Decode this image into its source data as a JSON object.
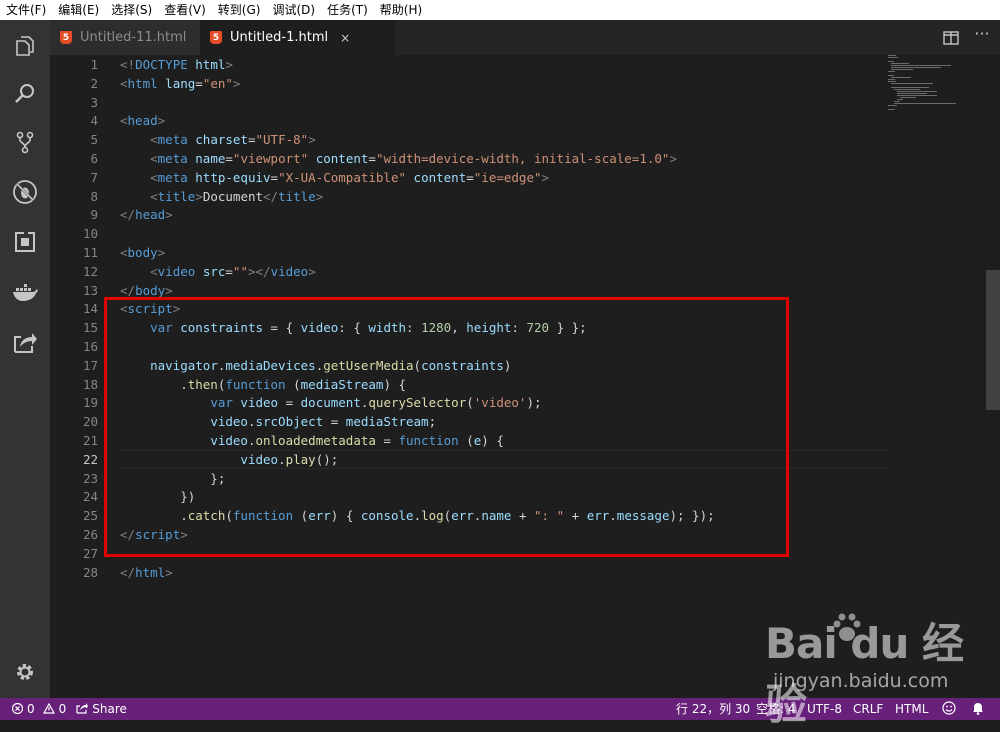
{
  "menu": [
    "文件(F)",
    "编辑(E)",
    "选择(S)",
    "查看(V)",
    "转到(G)",
    "调试(D)",
    "任务(T)",
    "帮助(H)"
  ],
  "activity_icons": [
    "files-icon",
    "search-icon",
    "source-control-icon",
    "debug-icon",
    "extensions-icon",
    "docker-icon",
    "live-share-icon",
    "settings-icon"
  ],
  "tabs": [
    {
      "label": "Untitled-11.html",
      "icon": "html5-icon",
      "active": false
    },
    {
      "label": "Untitled-1.html",
      "icon": "html5-icon",
      "active": true,
      "close": "×"
    }
  ],
  "html5_glyph": "5",
  "editor": {
    "active_line": 22,
    "highlight_box_color": "#e00000",
    "lines": [
      [
        [
          "tg",
          "<!"
        ],
        [
          "tn",
          "DOCTYPE"
        ],
        [
          "tx",
          " "
        ],
        [
          "at",
          "html"
        ],
        [
          "tg",
          ">"
        ]
      ],
      [
        [
          "tg",
          "<"
        ],
        [
          "tn",
          "html"
        ],
        [
          "tx",
          " "
        ],
        [
          "at",
          "lang"
        ],
        [
          "tx",
          "="
        ],
        [
          "st",
          "\"en\""
        ],
        [
          "tg",
          ">"
        ]
      ],
      [],
      [
        [
          "tg",
          "<"
        ],
        [
          "tn",
          "head"
        ],
        [
          "tg",
          ">"
        ]
      ],
      [
        [
          "tx",
          "    "
        ],
        [
          "tg",
          "<"
        ],
        [
          "tn",
          "meta"
        ],
        [
          "tx",
          " "
        ],
        [
          "at",
          "charset"
        ],
        [
          "tx",
          "="
        ],
        [
          "st",
          "\"UTF-8\""
        ],
        [
          "tg",
          ">"
        ]
      ],
      [
        [
          "tx",
          "    "
        ],
        [
          "tg",
          "<"
        ],
        [
          "tn",
          "meta"
        ],
        [
          "tx",
          " "
        ],
        [
          "at",
          "name"
        ],
        [
          "tx",
          "="
        ],
        [
          "st",
          "\"viewport\""
        ],
        [
          "tx",
          " "
        ],
        [
          "at",
          "content"
        ],
        [
          "tx",
          "="
        ],
        [
          "st",
          "\"width=device-width, initial-scale=1.0\""
        ],
        [
          "tg",
          ">"
        ]
      ],
      [
        [
          "tx",
          "    "
        ],
        [
          "tg",
          "<"
        ],
        [
          "tn",
          "meta"
        ],
        [
          "tx",
          " "
        ],
        [
          "at",
          "http-equiv"
        ],
        [
          "tx",
          "="
        ],
        [
          "st",
          "\"X-UA-Compatible\""
        ],
        [
          "tx",
          " "
        ],
        [
          "at",
          "content"
        ],
        [
          "tx",
          "="
        ],
        [
          "st",
          "\"ie=edge\""
        ],
        [
          "tg",
          ">"
        ]
      ],
      [
        [
          "tx",
          "    "
        ],
        [
          "tg",
          "<"
        ],
        [
          "tn",
          "title"
        ],
        [
          "tg",
          ">"
        ],
        [
          "tx",
          "Document"
        ],
        [
          "tg",
          "</"
        ],
        [
          "tn",
          "title"
        ],
        [
          "tg",
          ">"
        ]
      ],
      [
        [
          "tg",
          "</"
        ],
        [
          "tn",
          "head"
        ],
        [
          "tg",
          ">"
        ]
      ],
      [],
      [
        [
          "tg",
          "<"
        ],
        [
          "tn",
          "body"
        ],
        [
          "tg",
          ">"
        ]
      ],
      [
        [
          "tx",
          "    "
        ],
        [
          "tg",
          "<"
        ],
        [
          "tn",
          "video"
        ],
        [
          "tx",
          " "
        ],
        [
          "at",
          "src"
        ],
        [
          "tx",
          "="
        ],
        [
          "st",
          "\"\""
        ],
        [
          "tg",
          "></"
        ],
        [
          "tn",
          "video"
        ],
        [
          "tg",
          ">"
        ]
      ],
      [
        [
          "tg",
          "</"
        ],
        [
          "tn",
          "body"
        ],
        [
          "tg",
          ">"
        ]
      ],
      [
        [
          "tg",
          "<"
        ],
        [
          "tn",
          "script"
        ],
        [
          "tg",
          ">"
        ]
      ],
      [
        [
          "tx",
          "    "
        ],
        [
          "kw",
          "var"
        ],
        [
          "tx",
          " "
        ],
        [
          "vr",
          "constraints"
        ],
        [
          "tx",
          " = { "
        ],
        [
          "vr",
          "video"
        ],
        [
          "tx",
          ": { "
        ],
        [
          "vr",
          "width"
        ],
        [
          "tx",
          ": "
        ],
        [
          "nm",
          "1280"
        ],
        [
          "tx",
          ", "
        ],
        [
          "vr",
          "height"
        ],
        [
          "tx",
          ": "
        ],
        [
          "nm",
          "720"
        ],
        [
          "tx",
          " } };"
        ]
      ],
      [],
      [
        [
          "tx",
          "    "
        ],
        [
          "vr",
          "navigator"
        ],
        [
          "tx",
          "."
        ],
        [
          "vr",
          "mediaDevices"
        ],
        [
          "tx",
          "."
        ],
        [
          "fn",
          "getUserMedia"
        ],
        [
          "tx",
          "("
        ],
        [
          "vr",
          "constraints"
        ],
        [
          "tx",
          ")"
        ]
      ],
      [
        [
          "tx",
          "        ."
        ],
        [
          "fn",
          "then"
        ],
        [
          "tx",
          "("
        ],
        [
          "kw",
          "function"
        ],
        [
          "tx",
          " ("
        ],
        [
          "vr",
          "mediaStream"
        ],
        [
          "tx",
          ") {"
        ]
      ],
      [
        [
          "tx",
          "            "
        ],
        [
          "kw",
          "var"
        ],
        [
          "tx",
          " "
        ],
        [
          "vr",
          "video"
        ],
        [
          "tx",
          " = "
        ],
        [
          "vr",
          "document"
        ],
        [
          "tx",
          "."
        ],
        [
          "fn",
          "querySelector"
        ],
        [
          "tx",
          "("
        ],
        [
          "st",
          "'video'"
        ],
        [
          "tx",
          ");"
        ]
      ],
      [
        [
          "tx",
          "            "
        ],
        [
          "vr",
          "video"
        ],
        [
          "tx",
          "."
        ],
        [
          "vr",
          "srcObject"
        ],
        [
          "tx",
          " = "
        ],
        [
          "vr",
          "mediaStream"
        ],
        [
          "tx",
          ";"
        ]
      ],
      [
        [
          "tx",
          "            "
        ],
        [
          "vr",
          "video"
        ],
        [
          "tx",
          "."
        ],
        [
          "fn",
          "onloadedmetadata"
        ],
        [
          "tx",
          " = "
        ],
        [
          "kw",
          "function"
        ],
        [
          "tx",
          " ("
        ],
        [
          "vr",
          "e"
        ],
        [
          "tx",
          ") {"
        ]
      ],
      [
        [
          "tx",
          "                "
        ],
        [
          "vr",
          "video"
        ],
        [
          "tx",
          "."
        ],
        [
          "fn",
          "play"
        ],
        [
          "tx",
          "();"
        ]
      ],
      [
        [
          "tx",
          "            };"
        ]
      ],
      [
        [
          "tx",
          "        })"
        ]
      ],
      [
        [
          "tx",
          "        ."
        ],
        [
          "fn",
          "catch"
        ],
        [
          "tx",
          "("
        ],
        [
          "kw",
          "function"
        ],
        [
          "tx",
          " ("
        ],
        [
          "vr",
          "err"
        ],
        [
          "tx",
          ") { "
        ],
        [
          "vr",
          "console"
        ],
        [
          "tx",
          "."
        ],
        [
          "fn",
          "log"
        ],
        [
          "tx",
          "("
        ],
        [
          "vr",
          "err"
        ],
        [
          "tx",
          "."
        ],
        [
          "vr",
          "name"
        ],
        [
          "tx",
          " + "
        ],
        [
          "st",
          "\": \""
        ],
        [
          "tx",
          " + "
        ],
        [
          "vr",
          "err"
        ],
        [
          "tx",
          "."
        ],
        [
          "vr",
          "message"
        ],
        [
          "tx",
          "); });"
        ]
      ],
      [
        [
          "tg",
          "</"
        ],
        [
          "tn",
          "script"
        ],
        [
          "tg",
          ">"
        ]
      ],
      [],
      [
        [
          "tg",
          "</"
        ],
        [
          "tn",
          "html"
        ],
        [
          "tg",
          ">"
        ]
      ]
    ]
  },
  "status": {
    "errors": "0",
    "warnings": "0",
    "share": "Share",
    "position": "行 22，列 30",
    "spaces": "空格: 4",
    "encoding": "UTF-8",
    "eol": "CRLF",
    "language": "HTML"
  },
  "watermark": {
    "logo": "Bai du 经验",
    "url": "jingyan.baidu.com"
  }
}
